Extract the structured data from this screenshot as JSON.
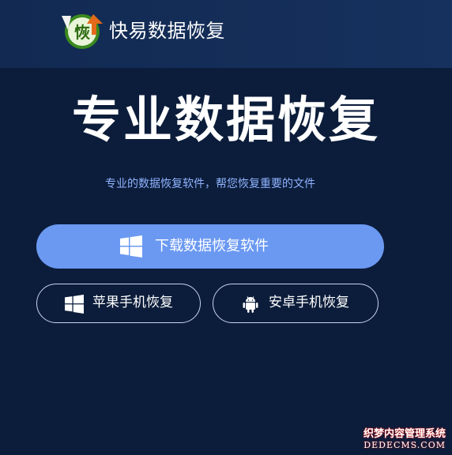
{
  "header": {
    "logo_text": "恢",
    "brand_name": "快易数据恢复"
  },
  "hero": {
    "title": "专业数据恢复",
    "subtitle": "专业的数据恢复软件，帮您恢复重要的文件"
  },
  "buttons": {
    "download_label": "下载数据恢复软件",
    "apple_label": "苹果手机恢复",
    "android_label": "安卓手机恢复"
  },
  "icons": {
    "download": "windows-icon",
    "apple": "windows-icon",
    "android": "android-icon"
  },
  "watermark": {
    "line1": "织梦内容管理系统",
    "line2": "DEDECMS.COM"
  },
  "colors": {
    "background": "#0c1d3b",
    "header": "#122a52",
    "primary_button": "#6b99f2",
    "subtitle": "#8fb4ff"
  }
}
